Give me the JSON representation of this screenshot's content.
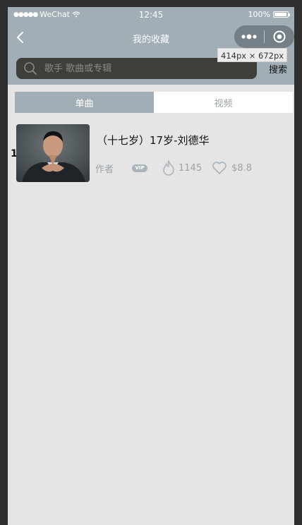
{
  "status_bar": {
    "carrier": "WeChat",
    "time": "12:45",
    "battery": "100%"
  },
  "nav": {
    "title": "我的收藏"
  },
  "search": {
    "placeholder": "歌手 歌曲或专辑",
    "button": "搜索"
  },
  "devtools": {
    "dimensions": "414px × 672px"
  },
  "tabs": [
    {
      "label": "单曲",
      "active": true
    },
    {
      "label": "视频",
      "active": false
    }
  ],
  "songs": [
    {
      "index": "1",
      "title": "（十七岁）17岁-刘德华",
      "author": "作者",
      "vip": "VIP",
      "plays": "1145",
      "price": "$8.8"
    }
  ],
  "colors": {
    "accent": "#a1aeb5",
    "background": "#e5e5e5",
    "search_box": "#3e3e3b",
    "meta_text": "#9aa3a8"
  },
  "icons": [
    "back-arrow-icon",
    "more-dots-icon",
    "target-close-icon",
    "search-icon",
    "vip-badge",
    "fire-icon",
    "heart-icon",
    "wifi-icon",
    "battery-icon"
  ]
}
